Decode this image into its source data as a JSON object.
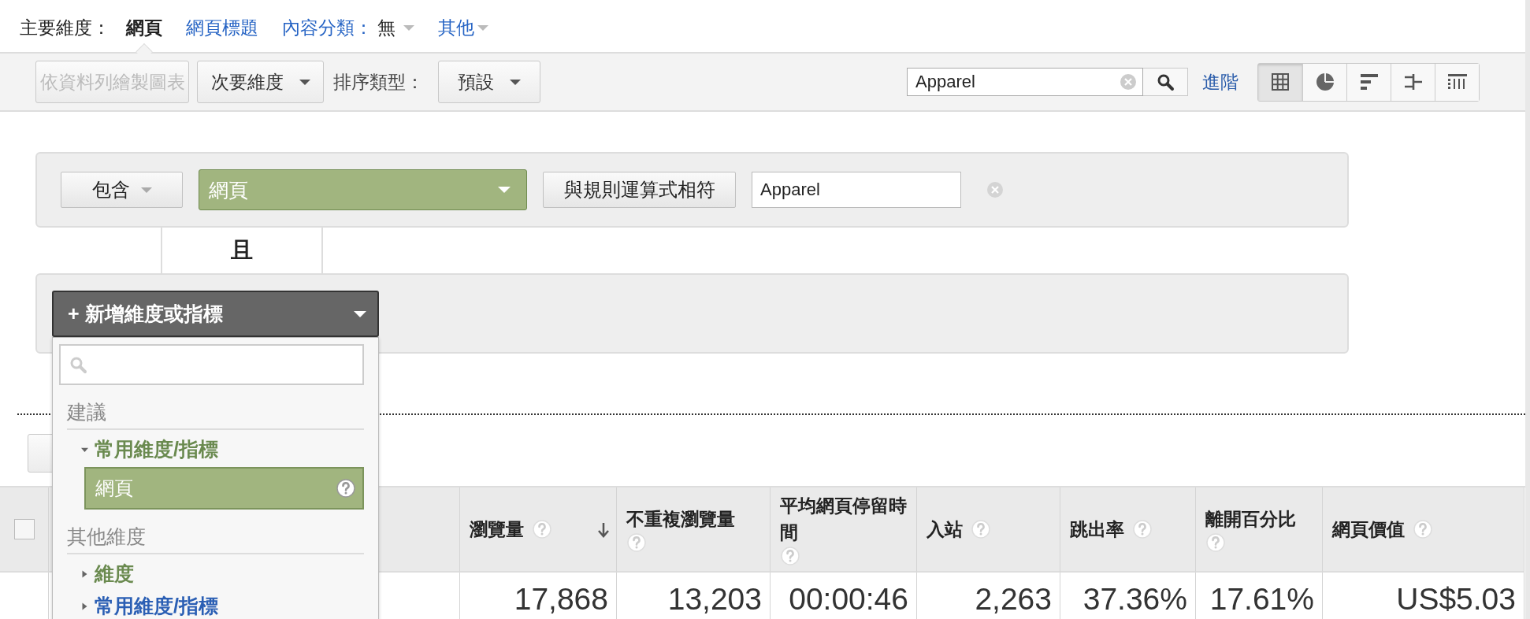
{
  "primary_dimension": {
    "label": "主要維度：",
    "options": [
      {
        "kind": "link",
        "label": "網頁",
        "selected": true
      },
      {
        "kind": "link",
        "label": "網頁標題",
        "selected": false
      },
      {
        "kind": "dropdown",
        "label": "內容分類：",
        "value": "無",
        "selected": false
      },
      {
        "kind": "dropdown",
        "label": "其他",
        "selected": false
      }
    ]
  },
  "toolbar": {
    "plot_rows_button": {
      "label": "依資料列繪製圖表",
      "disabled": true
    },
    "secondary_dimension": "次要維度",
    "sort_label": "排序類型：",
    "sort_value": "預設",
    "search": {
      "value": "Apparel"
    },
    "advanced_link": "進階",
    "views": [
      {
        "kind": "table",
        "selected": true
      },
      {
        "kind": "pie",
        "selected": false
      },
      {
        "kind": "bar",
        "selected": false
      },
      {
        "kind": "comparison",
        "selected": false
      },
      {
        "kind": "pivot",
        "selected": false
      }
    ]
  },
  "filter": {
    "include": "包含",
    "dimension": "網頁",
    "match": "與規則運算式相符",
    "value": "Apparel",
    "and_label": "且",
    "add_button": "+ 新增維度或指標"
  },
  "dropdown": {
    "items": [
      {
        "kind": "header",
        "label": "建議"
      },
      {
        "kind": "group",
        "label": "常用維度/指標",
        "expanded": true,
        "color": "#6a8a4f"
      },
      {
        "kind": "item",
        "label": "網頁",
        "selected": true
      },
      {
        "kind": "header",
        "label": "其他維度"
      },
      {
        "kind": "group",
        "label": "維度",
        "expanded": false,
        "color": "#6a8a4f"
      },
      {
        "kind": "group",
        "label": "常用維度/指標",
        "expanded": false,
        "color": "#2b5fb4"
      }
    ]
  },
  "table": {
    "select_all": {
      "checked": false
    },
    "columns": [
      {
        "label": "瀏覽量",
        "sorted": true
      },
      {
        "label": "不重複瀏覽量",
        "sorted": false
      },
      {
        "label": "平均網頁停留時間",
        "sorted": false
      },
      {
        "label": "入站",
        "sorted": false
      },
      {
        "label": "跳出率",
        "sorted": false
      },
      {
        "label": "離開百分比",
        "sorted": false
      },
      {
        "label": "網頁價值",
        "sorted": false
      }
    ],
    "rows": [
      {
        "values": [
          "17,868",
          "13,203",
          "00:00:46",
          "2,263",
          "37.36%",
          "17.61%",
          "US$5.03"
        ]
      }
    ]
  }
}
